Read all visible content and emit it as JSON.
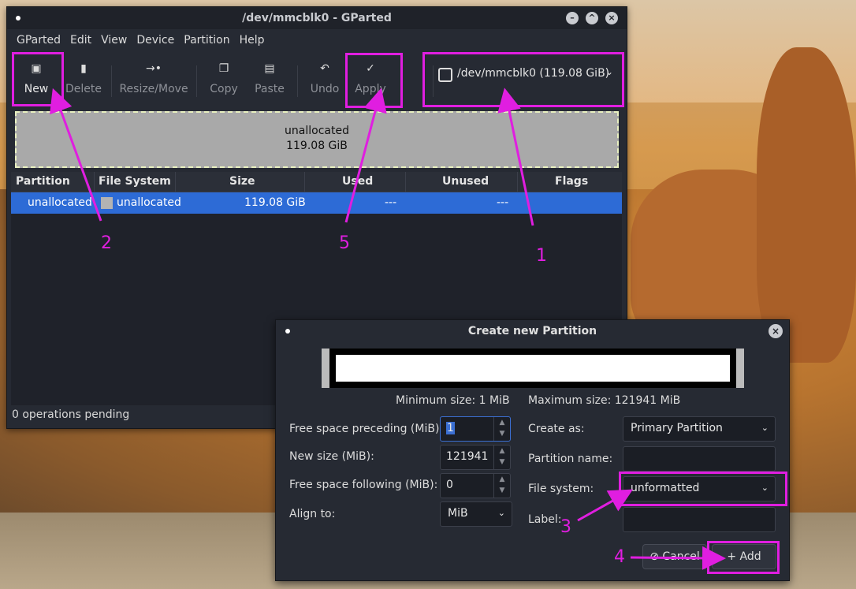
{
  "window": {
    "title": "/dev/mmcblk0 - GParted",
    "menu": [
      "GParted",
      "Edit",
      "View",
      "Device",
      "Partition",
      "Help"
    ],
    "toolbar": [
      {
        "label": "New",
        "icon": "new-partition-icon",
        "enabled": true
      },
      {
        "label": "Delete",
        "icon": "trash-icon",
        "enabled": false
      },
      {
        "label": "Resize/Move",
        "icon": "resize-move-icon",
        "enabled": false
      },
      {
        "label": "Copy",
        "icon": "copy-icon",
        "enabled": false
      },
      {
        "label": "Paste",
        "icon": "paste-icon",
        "enabled": false
      },
      {
        "label": "Undo",
        "icon": "undo-icon",
        "enabled": false
      },
      {
        "label": "Apply",
        "icon": "checkmark-icon",
        "enabled": false
      }
    ],
    "device_selector": "/dev/mmcblk0  (119.08 GiB)",
    "disk_map": {
      "line1": "unallocated",
      "line2": "119.08 GiB"
    },
    "columns": [
      "Partition",
      "File System",
      "Size",
      "Used",
      "Unused",
      "Flags"
    ],
    "rows": [
      {
        "partition": "unallocated",
        "filesystem": "unallocated",
        "size": "119.08 GiB",
        "used": "---",
        "unused": "---",
        "flags": ""
      }
    ],
    "status": "0 operations pending"
  },
  "dialog": {
    "title": "Create new Partition",
    "min_size": "Minimum size: 1 MiB",
    "max_size": "Maximum size: 121941 MiB",
    "free_preceding_label": "Free space preceding (MiB):",
    "free_preceding_value": "1",
    "new_size_label": "New size (MiB):",
    "new_size_value": "121941",
    "free_following_label": "Free space following (MiB):",
    "free_following_value": "0",
    "align_label": "Align to:",
    "align_value": "MiB",
    "create_as_label": "Create as:",
    "create_as_value": "Primary Partition",
    "partition_name_label": "Partition name:",
    "file_system_label": "File system:",
    "file_system_value": "unformatted",
    "label_label": "Label:",
    "cancel_label": "Cancel",
    "add_label": "+ Add"
  },
  "annotations": [
    "1",
    "2",
    "3",
    "4",
    "5"
  ],
  "colors": {
    "annotation": "#e01ee0",
    "selection": "#2d6bd6",
    "window_bg": "#262a33"
  }
}
